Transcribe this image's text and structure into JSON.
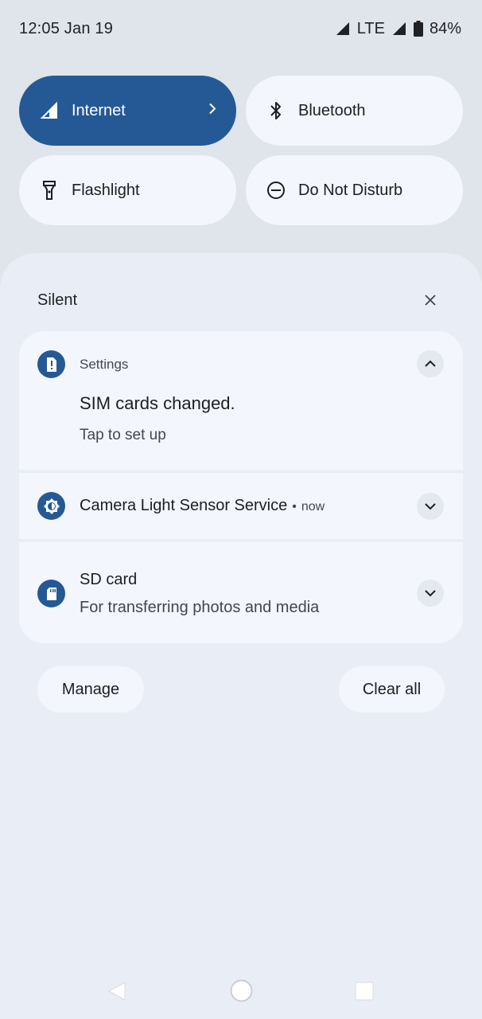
{
  "status_bar": {
    "time_date": "12:05  Jan 19",
    "network": "LTE",
    "battery": "84%",
    "icons": [
      "signal-icon",
      "lte-signal-icon",
      "battery-icon"
    ]
  },
  "quick_settings": {
    "tiles": [
      {
        "label": "Internet",
        "icon": "signal-icon",
        "active": true
      },
      {
        "label": "Bluetooth",
        "icon": "bluetooth-icon",
        "active": false
      },
      {
        "label": "Flashlight",
        "icon": "flashlight-icon",
        "active": false
      },
      {
        "label": "Do Not Disturb",
        "icon": "do-not-disturb-icon",
        "active": false
      }
    ]
  },
  "shade": {
    "section_label": "Silent",
    "notifications": [
      {
        "app": "Settings",
        "title": "SIM cards changed.",
        "text": "Tap to set up",
        "expanded": true
      },
      {
        "title": "Camera Light Sensor Service",
        "separator": "•",
        "time": "now",
        "expanded": false
      },
      {
        "title": "SD card",
        "text": "For transferring photos and media",
        "expanded": false
      }
    ],
    "manage_label": "Manage",
    "clear_all_label": "Clear all"
  },
  "colors": {
    "accent": "#245996",
    "background": "#e0e4eb",
    "shade": "#e9eef6",
    "tile": "#f3f6fc"
  }
}
